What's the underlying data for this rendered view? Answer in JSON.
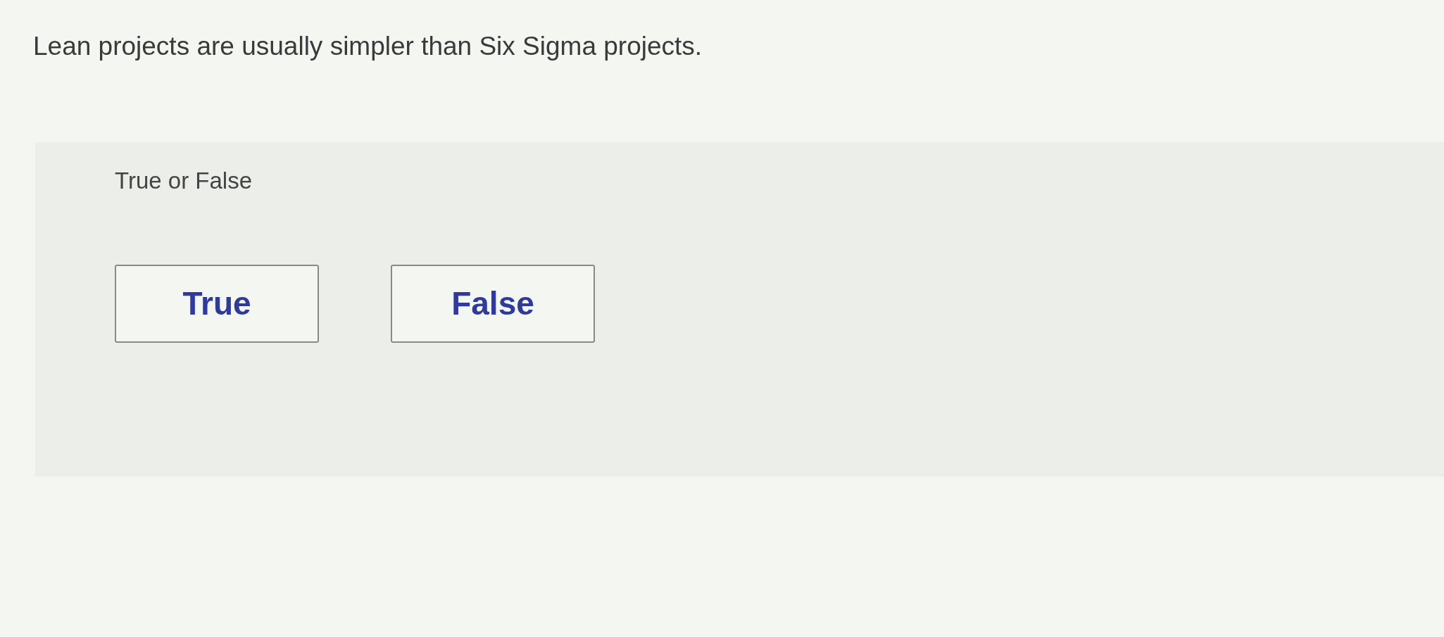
{
  "question": "Lean projects are usually simpler than Six Sigma projects.",
  "prompt": "True or False",
  "options": [
    {
      "label": "True",
      "selected": false
    },
    {
      "label": "False",
      "selected": false
    }
  ]
}
